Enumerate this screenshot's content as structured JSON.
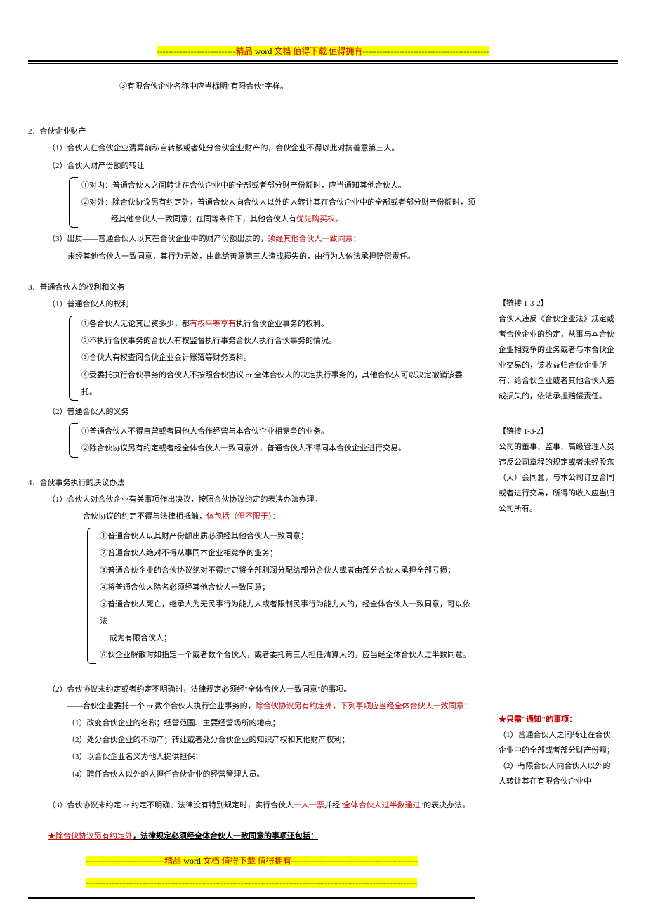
{
  "banner": {
    "dash": "----------------------------",
    "text1": "精品",
    "word": "word",
    "text2": "文档  值得下载  值得拥有",
    "tail": "---------------------------------------------"
  },
  "top_line": "③有限合伙企业名称中应当标明\"有限合伙\"字样。",
  "sec2": {
    "title": "2．合伙企业财产",
    "p1": "（1）合伙人在合伙企业清算前私自转移或者处分合伙企业财产的，合伙企业不得以此对抗善意第三人。",
    "p2": "（2）合伙人财产份额的转让",
    "b1": "①对内：普通合伙人之间转让在合伙企业中的全部或者部分财产份额时，应当通知其他合伙人。",
    "b2a": "②对外：除合伙协议另有约定外，普通合伙人向合伙人以外的人转让其在合伙企业中的全部或者部分财产份额时，须",
    "b2b": "经其他合伙人一致同意；在同等条件下，其他合伙人有",
    "b2b_red": "优先购买权。",
    "p3a": "（3）出质——普通合伙人以其在合伙企业中的财产份额出质的，",
    "p3a_red": "须经其他合伙人一致同意；",
    "p3b": "未经其他合伙人一致同意，其行为无效，由此给善意第三人造成损失的，由行为人依法承担赔偿责任。"
  },
  "sec3": {
    "title": "3．普通合伙人的权利和义务",
    "p1": "（1）普通合伙人的权利",
    "r1a": "①各合伙人无论其出资多少，都",
    "r1b_red": "有权平等享有",
    "r1c": "执行合伙企业事务的权利。",
    "r2": "②不执行合伙事务的合伙人有权监督执行事务合伙人执行合伙事务的情况。",
    "r3": "③合伙人有权查阅合伙企业会计账簿等财务资料。",
    "r4": "④受委托执行合伙事务的合伙人不按照合伙协议 or 全体合伙人的决定执行事务的，其他合伙人可以决定撤销该委托。",
    "p2": "（2）普通合伙人的义务",
    "d1": "①普通合伙人不得自营或者同他人合作经营与本合伙企业相竞争的业务。",
    "d2": "②除合伙协议另有约定或者经全体合伙人一致同意外，普通合伙人不得同本合伙企业进行交易。"
  },
  "sec4": {
    "title": "4．合伙事务执行的决议办法",
    "p1": "（1）合伙人对合伙企业有关事项作出决议，按照合伙协议约定的表决办法办理。",
    "note_a": "——合伙协议的约定不得与法律相抵触，",
    "note_b_red": "体包括（但不限于）：",
    "b1": "①普通合伙人以其财产份额出质必须经其他合伙人一致同意；",
    "b2": "②普通合伙人绝对不得从事同本企业相竞争的业务；",
    "b3": "③普通合伙企业的合伙协议绝对不得约定将全部利润分配给部分合伙人或者由部分合伙人承担全部亏损；",
    "b4": "④将普通合伙人除名必须经其他合伙人一致同意；",
    "b5a": "⑤普通合伙人死亡，继承人为无民事行为能力人或者限制民事行为能力人的，经全体合伙人一致同意，可以依法",
    "b5b": "成为有限合伙人；",
    "b6": "⑥伙企业解散时如指定一个或者数个合伙人，或者委托第三人担任清算人的，应当经全体合伙人过半数同意。",
    "p2": "（2）合伙协议未约定或者约定不明确时，法律规定必须经\"全体合伙人一致同意\"的事项。",
    "note2a": "——合伙企业委托一个 or 数个合伙人执行企业事务的，",
    "note2b_red": "除合伙协议另有约定外，下列事项应当经全体合伙人一致同意：",
    "s1": "（1）改变合伙企业的名称；经营范围、主要经营场所的地点；",
    "s2": "（2）处分合伙企业的不动产；转让或者处分合伙企业的知识产权和其他财产权利；",
    "s3": "（3）以合伙企业名义为他人提供担保；",
    "s4": "（4）聘任合伙人以外的人担任合伙企业的经营管理人员。",
    "p3a": "（3）合伙协议未约定 or 约定不明确、法律没有特别规定时，实行合伙人",
    "p3b_red": "一人一票",
    "p3c": "并经\"",
    "p3d_red": "全体合伙人过半数通过",
    "p3e": "\"的表决办法。",
    "star_red": "★除合伙协议另有约定外",
    "star_black": "，法律规定必须经全体合伙人一致同意的事项还包括："
  },
  "side": {
    "link1_title": "【链接 1-3-2】",
    "link1_body": "合伙人违反《合伙企业法》规定或者合伙企业的约定，从事与本合伙企业相竞争的业务或者与本合伙企业交易的，该收益归合伙企业所有；给合伙企业或者其他合伙人造成损失的，依法承担赔偿责任。",
    "link2_title": "【链接 1-3-2】",
    "link2_body": "公司的董事、监事、高级管理人员违反公司章程的规定或者未经股东（大）会同意，与本公司订立合同或者进行交易，所得的收入应当归公司所有。",
    "link3_title": "★只需\"通知\"的事项：",
    "link3_p1": "（1）普通合伙人之间转让在合伙企业中的全部或者部分财产份额；",
    "link3_p2": "（2）有限合伙人向合伙人以外的人转让其在有限合伙企业中"
  }
}
